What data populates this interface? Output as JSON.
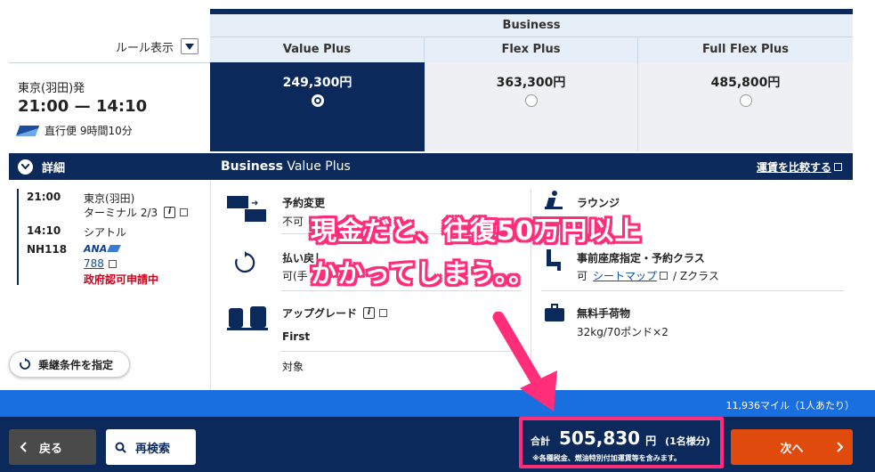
{
  "header": {
    "cabin": "Business",
    "rule_label": "ルール表示",
    "fares": [
      {
        "name": "Value Plus",
        "price": "249,300円",
        "selected": true
      },
      {
        "name": "Flex Plus",
        "price": "363,300円",
        "selected": false
      },
      {
        "name": "Full Flex Plus",
        "price": "485,800円",
        "selected": false
      }
    ]
  },
  "flight": {
    "origin": "東京(羽田)発",
    "time": "21:00 — 14:10",
    "duration": "直行便 9時間10分",
    "details_label": "詳細",
    "dep_time": "21:00",
    "dep_airport": "東京(羽田)",
    "dep_terminal": "ターミナル 2/3",
    "arr_time": "14:10",
    "arr_city": "シアトル",
    "flight_no": "NH118",
    "aircraft": "788",
    "approval": "政府認可申請中",
    "transit_button": "乗継条件を指定"
  },
  "fare_detail": {
    "title_bold": "Business",
    "title_rest": " Value Plus",
    "compare_link": "運賃を比較する",
    "change_label": "予約変更",
    "change_value": "不可",
    "refund_label": "払い戻し",
    "refund_value": "可(手",
    "upgrade_label": "アップグレード",
    "upgrade_class": "First",
    "upgrade_target": "対象",
    "lounge_label": "ラウンジ",
    "seat_label": "事前座席指定・予約クラス",
    "seat_value_pre": "可",
    "seat_map_link": "シートマップ",
    "seat_value_post": "/ Zクラス",
    "baggage_label": "無料手荷物",
    "baggage_value": "32kg/70ポンド×2"
  },
  "overlay": {
    "line1": "現金だと、往復50万円以上",
    "line2": "かかってしまう。。"
  },
  "miles": "11,936マイル（1人あたり）",
  "footer": {
    "back": "戻る",
    "research": "再検索",
    "total_label": "合計",
    "total_value": "505,830",
    "total_unit": "円",
    "total_per": "(1名様分)",
    "total_note": "※各種税金、燃油特別付加運賃等を含みます。",
    "next": "次へ"
  },
  "colors": {
    "navy": "#0b2a5b",
    "blue_bar": "#1a6fe0",
    "accent_orange": "#e04a0c",
    "highlight_pink": "#ff2d7a"
  }
}
